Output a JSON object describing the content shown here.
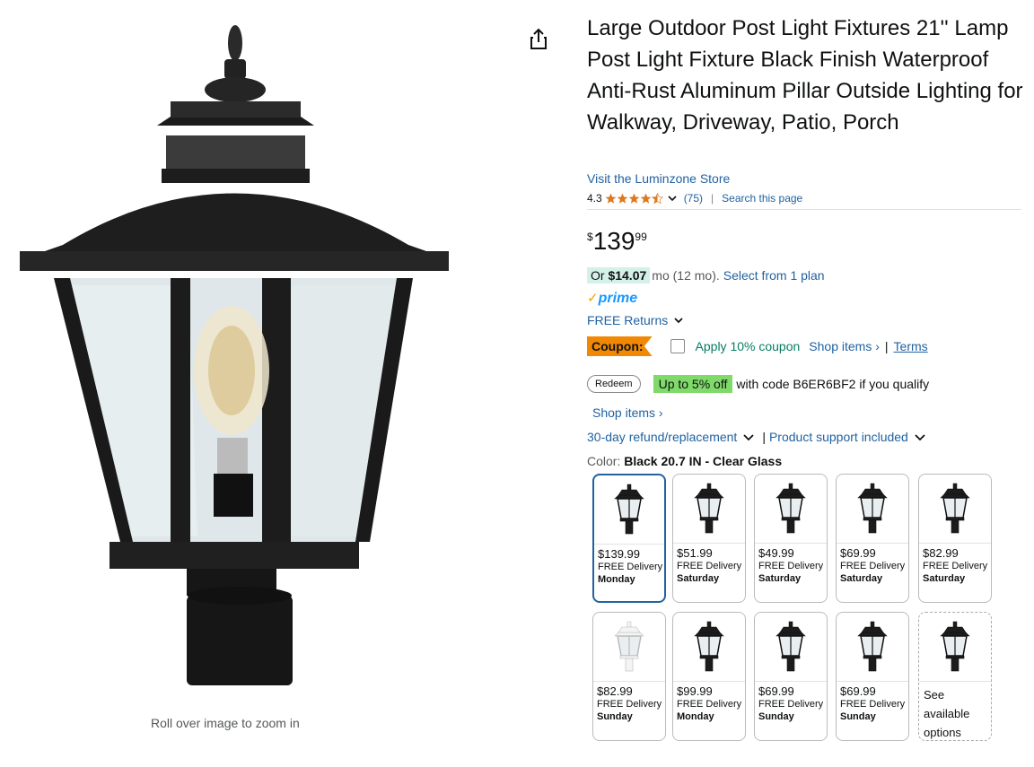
{
  "image": {
    "zoom_hint": "Roll over image to zoom in"
  },
  "product": {
    "title": "Large Outdoor Post Light Fixtures 21'' Lamp Post Light Fixture Black Finish Waterproof Anti-Rust Aluminum Pillar Outside Lighting for Walkway, Driveway, Patio, Porch",
    "store_link": "Visit the Luminzone Store",
    "rating": "4.3",
    "rating_stars": 4.3,
    "review_count": "(75)",
    "search_page": "Search this page"
  },
  "price": {
    "currency": "$",
    "whole": "139",
    "fraction": "99"
  },
  "installment": {
    "or": "Or",
    "amount": "$14.07",
    "period": "mo (12 mo).",
    "plan_link": "Select from 1 plan"
  },
  "prime": {
    "label": "prime",
    "check": "✓"
  },
  "returns": {
    "label": "FREE Returns"
  },
  "coupon": {
    "tag": "Coupon:",
    "apply": "Apply 10% coupon",
    "shop_items": "Shop items ›",
    "pipe": "|",
    "terms": "Terms"
  },
  "promo": {
    "redeem": "Redeem",
    "badge": "Up to 5% off",
    "text": "with code B6ER6BF2 if you qualify"
  },
  "shop_items": "Shop items ›",
  "policy": {
    "refund": "30-day refund/replacement",
    "bar": "|",
    "support": "Product support included"
  },
  "color": {
    "label": "Color: ",
    "value": "Black 20.7 IN - Clear Glass"
  },
  "swatches": [
    {
      "price": "$139.99",
      "delivery": "FREE Delivery",
      "day": "Monday",
      "lamp": "black"
    },
    {
      "price": "$51.99",
      "delivery": "FREE Delivery",
      "day": "Saturday",
      "lamp": "black"
    },
    {
      "price": "$49.99",
      "delivery": "FREE Delivery",
      "day": "Saturday",
      "lamp": "black"
    },
    {
      "price": "$69.99",
      "delivery": "FREE Delivery",
      "day": "Saturday",
      "lamp": "black"
    },
    {
      "price": "$82.99",
      "delivery": "FREE Delivery",
      "day": "Saturday",
      "lamp": "black"
    },
    {
      "price": "$82.99",
      "delivery": "FREE Delivery",
      "day": "Sunday",
      "lamp": "white"
    },
    {
      "price": "$99.99",
      "delivery": "FREE Delivery",
      "day": "Monday",
      "lamp": "black"
    },
    {
      "price": "$69.99",
      "delivery": "FREE Delivery",
      "day": "Sunday",
      "lamp": "black"
    },
    {
      "price": "$69.99",
      "delivery": "FREE Delivery",
      "day": "Sunday",
      "lamp": "black"
    },
    {
      "see": "See available options",
      "lamp": "black"
    }
  ],
  "colors": {
    "link": "#2162a1",
    "coupon": "#f08804",
    "green_badge": "#7fda69",
    "apply": "#067d62",
    "star": "#de7921"
  }
}
